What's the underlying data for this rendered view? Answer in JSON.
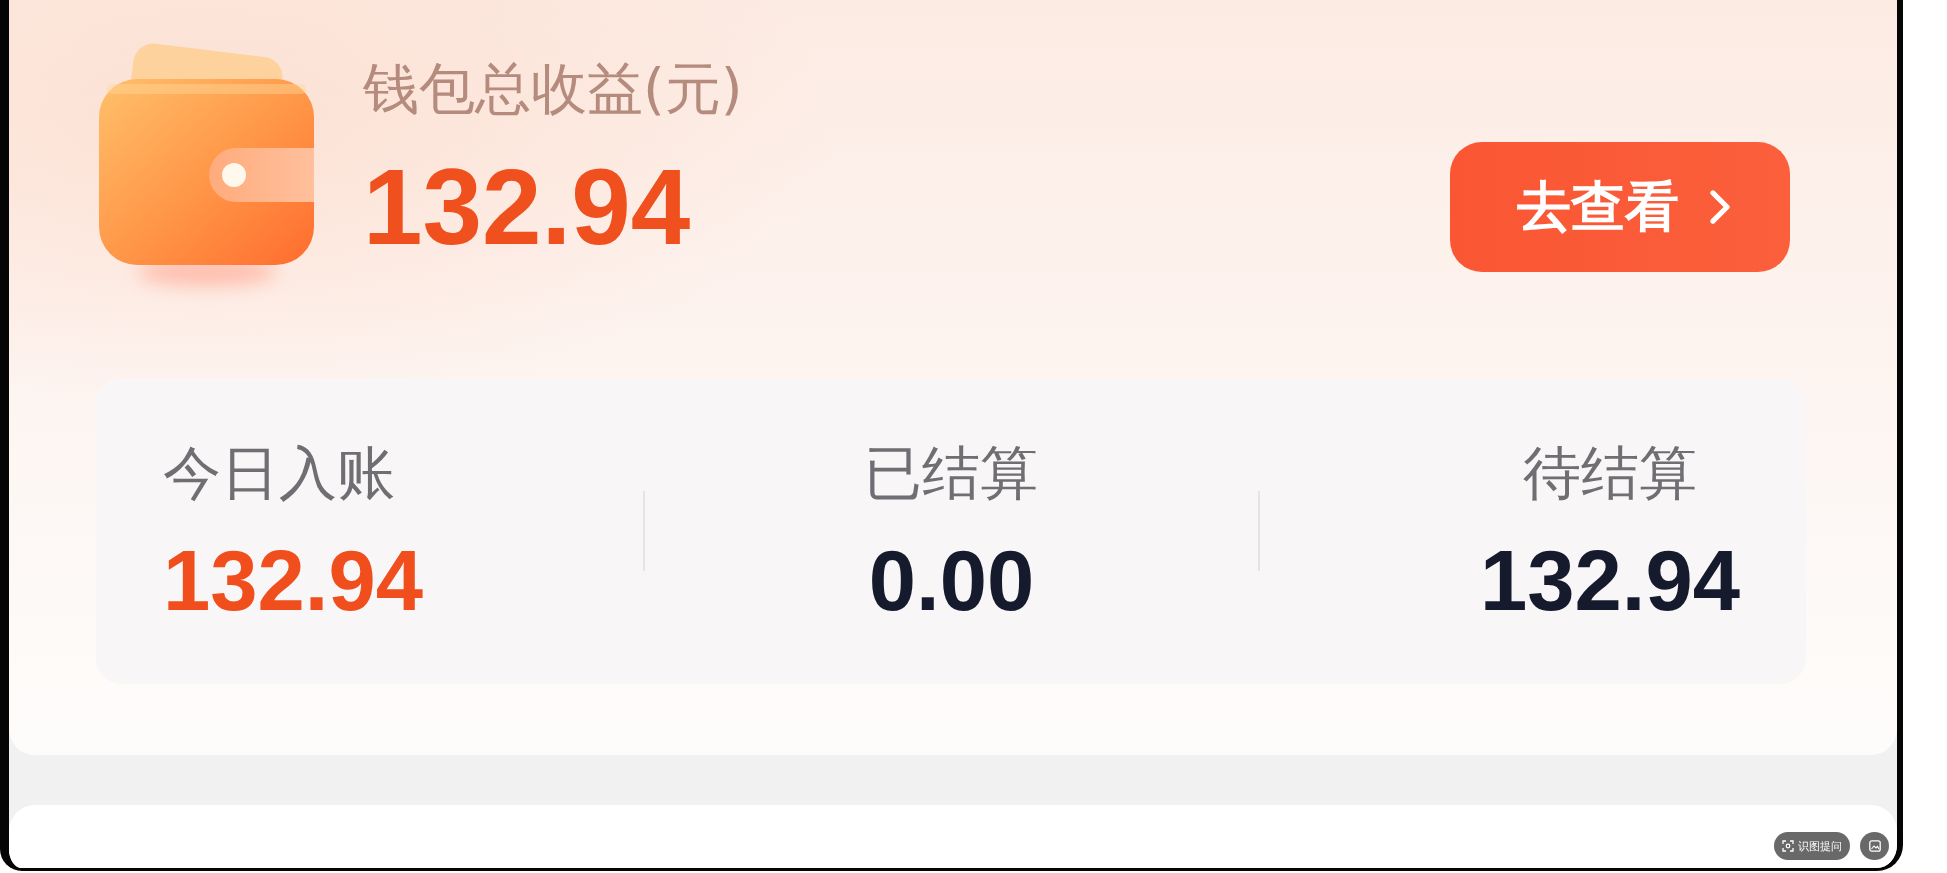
{
  "wallet": {
    "title": "钱包总收益(元)",
    "amount": "132.94",
    "action": {
      "label": "去查看"
    }
  },
  "stats": [
    {
      "label": "今日入账",
      "value": "132.94",
      "color": "#f04e1c"
    },
    {
      "label": "已结算",
      "value": "0.00",
      "color": "#161a2d"
    },
    {
      "label": "待结算",
      "value": "132.94",
      "color": "#161a2d"
    }
  ],
  "image_toolbar": {
    "ask_button": {
      "label": "识图提问"
    }
  }
}
